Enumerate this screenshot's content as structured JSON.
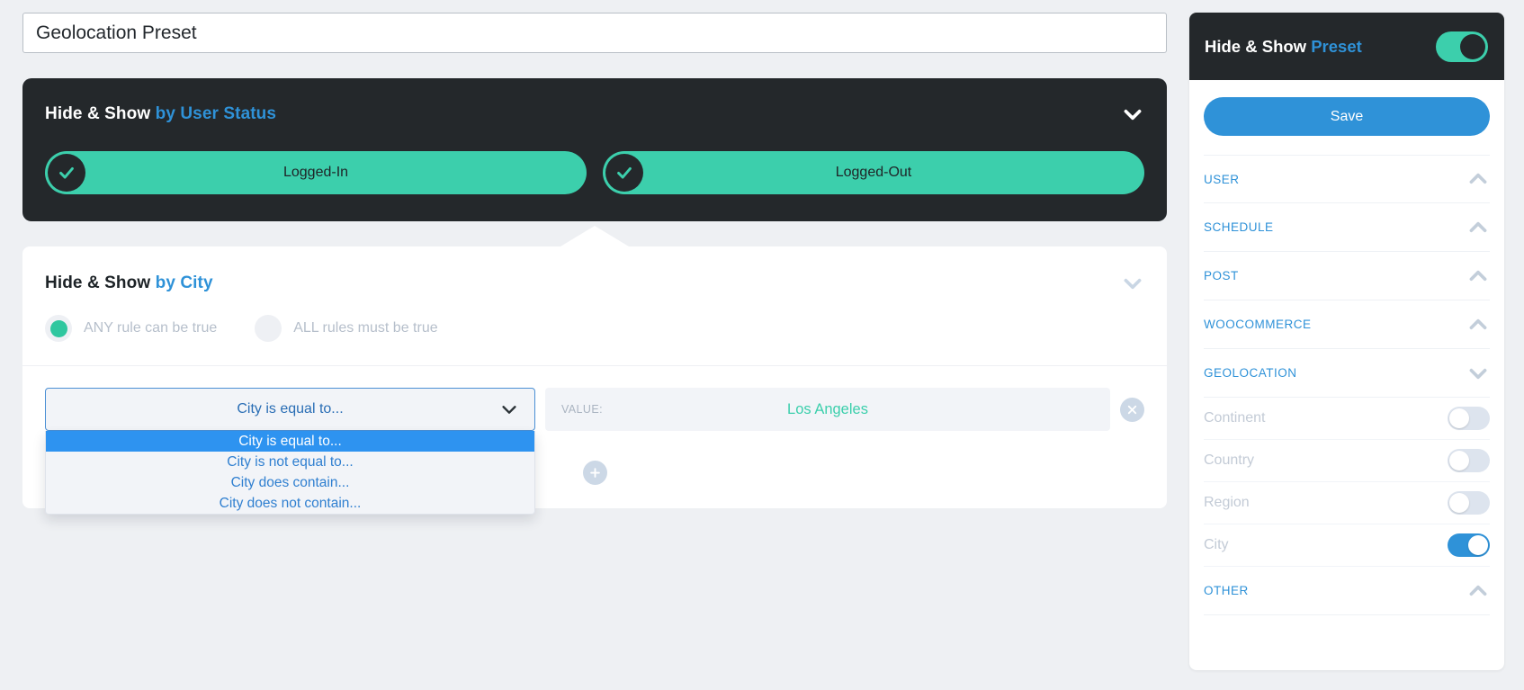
{
  "preset_title": {
    "value": "Geolocation Preset",
    "placeholder": "Enter preset title"
  },
  "user_status_card": {
    "title_prefix": "Hide & Show ",
    "title_accent": "by User Status",
    "options": [
      {
        "label": "Logged-In",
        "checked": true
      },
      {
        "label": "Logged-Out",
        "checked": true
      }
    ]
  },
  "city_card": {
    "title_prefix": "Hide & Show ",
    "title_accent": "by City",
    "match_modes": [
      {
        "label": "ANY rule can be true",
        "selected": true
      },
      {
        "label": "ALL rules must be true",
        "selected": false
      }
    ],
    "rule": {
      "selected_condition": "City is equal to...",
      "options": [
        {
          "label": "City is equal to...",
          "highlighted": true
        },
        {
          "label": "City is not equal to...",
          "highlighted": false
        },
        {
          "label": "City does contain...",
          "highlighted": false
        },
        {
          "label": "City does not contain...",
          "highlighted": false
        }
      ],
      "value_label": "VALUE:",
      "value_text": "Los Angeles",
      "remove_icon": "close-circle-icon"
    },
    "add_rule_icon": "plus-circle-icon"
  },
  "sidebar": {
    "header": {
      "title_prefix": "Hide & Show ",
      "title_accent": "Preset",
      "toggle_on": true
    },
    "save_label": "Save",
    "sections": [
      {
        "label": "USER",
        "expanded": false
      },
      {
        "label": "SCHEDULE",
        "expanded": false
      },
      {
        "label": "POST",
        "expanded": false
      },
      {
        "label": "WOOCOMMERCE",
        "expanded": false
      },
      {
        "label": "GEOLOCATION",
        "expanded": true
      }
    ],
    "geolocation_items": [
      {
        "label": "Continent",
        "on": false
      },
      {
        "label": "Country",
        "on": false
      },
      {
        "label": "Region",
        "on": false
      },
      {
        "label": "City",
        "on": true
      }
    ],
    "footer_section": {
      "label": "OTHER",
      "expanded": false
    }
  },
  "colors": {
    "dark": "#24282b",
    "teal": "#3ccfac",
    "blue": "#2f92d8",
    "highlight_blue": "#2e93f0",
    "page_bg": "#eef0f3"
  }
}
